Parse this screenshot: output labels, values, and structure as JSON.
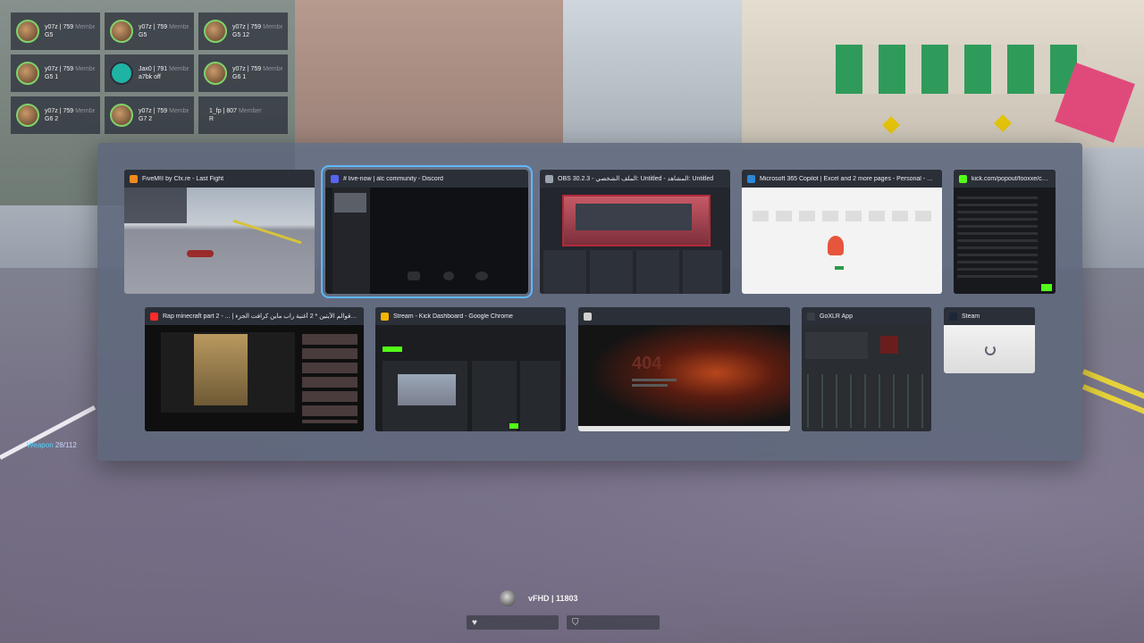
{
  "players": [
    {
      "name": "y07z | 759",
      "role": "Member",
      "sub": "G5",
      "avatar": "face"
    },
    {
      "name": "y07z | 759",
      "role": "Member",
      "sub": "G5",
      "avatar": "face"
    },
    {
      "name": "y07z | 759",
      "role": "Member",
      "sub": "G5 12",
      "avatar": "face"
    },
    {
      "name": "y07z | 759",
      "role": "Member",
      "sub": "G5 1",
      "avatar": "face"
    },
    {
      "name": "Jax0 | 791",
      "role": "Member",
      "sub": "a7bk off",
      "avatar": "teal"
    },
    {
      "name": "y07z | 759",
      "role": "Member",
      "sub": "G6 1",
      "avatar": "face"
    },
    {
      "name": "y07z | 759",
      "role": "Member",
      "sub": "G6 2",
      "avatar": "face"
    },
    {
      "name": "y07z | 759",
      "role": "Member",
      "sub": "G7 2",
      "avatar": "face"
    },
    {
      "name": "1_fp | 807",
      "role": "Member",
      "sub": "R",
      "avatar": "none"
    }
  ],
  "windows": [
    {
      "title": "FiveM® by Cfx.re - Last Fight",
      "icon_color": "#f08a1c",
      "icon": "fivem-icon"
    },
    {
      "title": "# live-now | alc community - Discord",
      "icon_color": "#5865f2",
      "icon": "discord-icon"
    },
    {
      "title": "OBS 30.2.3 - الملف الشخصي: Untitled - المشاهد: Untitled",
      "icon_color": "#9aa3ae",
      "icon": "obs-icon"
    },
    {
      "title": "Microsoft 365 Copilot | Excel and 2 more pages - Personal - Microsoft…",
      "icon_color": "#2b88d8",
      "icon": "edge-icon"
    },
    {
      "title": "kick.com/popout/fooxxe/chat…",
      "icon_color": "#53fc18",
      "icon": "kick-icon"
    },
    {
      "title": "Rap minecraft part 2 - ... | أغنية حصرية ) * قوالم الأيتين * 2 أغنية راب ماين كرافت الجزء",
      "icon_color": "#ff2b2b",
      "icon": "youtube-icon"
    },
    {
      "title": "Stream - Kick Dashboard - Google Chrome",
      "icon_color": "#f4b400",
      "icon": "chrome-icon"
    },
    {
      "title": "",
      "icon_color": "#d0d0d0",
      "icon": "blank-icon"
    },
    {
      "title": "GoXLR App",
      "icon_color": "#3a3f47",
      "icon": "goxlr-icon"
    },
    {
      "title": "Steam",
      "icon_color": "#1b2838",
      "icon": "steam-icon"
    }
  ],
  "hud": {
    "player": "vFHD | 11803",
    "health_icon": "heart-icon",
    "armor_icon": "shield-icon",
    "left_tag_name": "Weapon",
    "left_tag_value": "28/112"
  }
}
